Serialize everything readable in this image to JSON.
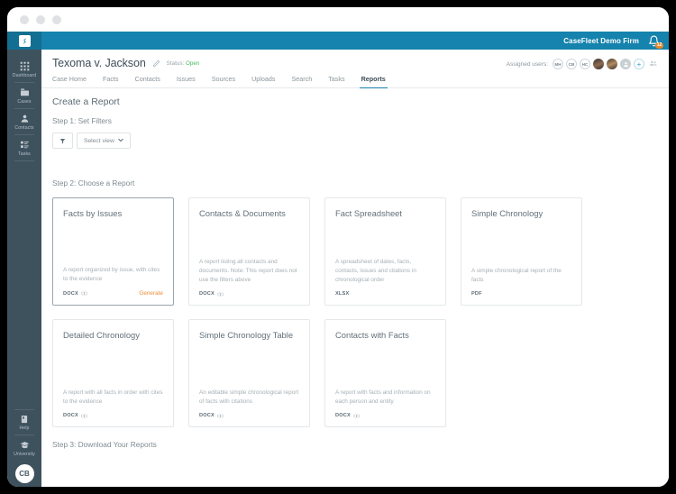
{
  "window": {
    "traffic_lights": [
      "close",
      "minimize",
      "maximize"
    ]
  },
  "brandbar": {
    "logo_glyph": "∈",
    "firm_name": "CaseFleet Demo Firm",
    "bell_icon": "bell-icon",
    "notification_count": "12"
  },
  "rail": {
    "items": [
      {
        "label": "Dashboard",
        "icon": "grid-icon"
      },
      {
        "label": "Cases",
        "icon": "folder-icon"
      },
      {
        "label": "Contacts",
        "icon": "person-icon"
      },
      {
        "label": "Tasks",
        "icon": "task-list-icon"
      }
    ],
    "bottom": [
      {
        "label": "Help",
        "icon": "book-icon"
      },
      {
        "label": "University",
        "icon": "graduation-cap-icon"
      }
    ],
    "avatar_initials": "CB"
  },
  "case_header": {
    "title": "Texoma v. Jackson",
    "edit_icon": "pencil-icon",
    "status_label": "Status:",
    "status_value": "Open",
    "status_color": "#4cb963",
    "assigned_label": "Assigned users:",
    "avatars": [
      {
        "type": "initials",
        "label": "MH"
      },
      {
        "type": "initials",
        "label": "CB"
      },
      {
        "type": "initials",
        "label": "HC"
      },
      {
        "type": "photo-a",
        "label": ""
      },
      {
        "type": "photo-b",
        "label": ""
      },
      {
        "type": "ghost",
        "label": ""
      }
    ],
    "add_user_label": "+",
    "manage_users_icon": "people-group-icon"
  },
  "tabs": [
    {
      "label": "Case Home",
      "active": false
    },
    {
      "label": "Facts",
      "active": false
    },
    {
      "label": "Contacts",
      "active": false
    },
    {
      "label": "Issues",
      "active": false
    },
    {
      "label": "Sources",
      "active": false
    },
    {
      "label": "Uploads",
      "active": false
    },
    {
      "label": "Search",
      "active": false
    },
    {
      "label": "Tasks",
      "active": false
    },
    {
      "label": "Reports",
      "active": true
    }
  ],
  "main": {
    "page_title": "Create a Report",
    "step1_label": "Step 1: Set Filters",
    "filter_icon": "funnel-icon",
    "select_view_label": "Select view",
    "select_view_caret": "⌄",
    "step2_label": "Step 2: Choose a Report",
    "step3_label": "Step 3: Download Your Reports",
    "generate_label": "Generate",
    "cards": [
      {
        "title": "Facts by Issues",
        "description": "A report organized by issue, with cites to the evidence",
        "format": "DOCX",
        "preview_icon": "preview-icon",
        "highlighted": true,
        "show_generate": true
      },
      {
        "title": "Contacts & Documents",
        "description": "A report listing all contacts and documents. Note: This report does not use the filters above",
        "format": "DOCX",
        "preview_icon": "preview-icon",
        "highlighted": false,
        "show_generate": false
      },
      {
        "title": "Fact Spreadsheet",
        "description": "A spreadsheet of dates, facts, contacts, issues and citations in chronological order",
        "format": "XLSX",
        "preview_icon": "",
        "highlighted": false,
        "show_generate": false
      },
      {
        "title": "Simple Chronology",
        "description": "A simple chronological report of the facts",
        "format": "PDF",
        "preview_icon": "",
        "highlighted": false,
        "show_generate": false
      },
      {
        "title": "Detailed Chronology",
        "description": "A report with all facts in order with cites to the evidence",
        "format": "DOCX",
        "preview_icon": "preview-icon",
        "highlighted": false,
        "show_generate": false
      },
      {
        "title": "Simple Chronology Table",
        "description": "An editable simple chronological report of facts with citations",
        "format": "DOCX",
        "preview_icon": "preview-icon",
        "highlighted": false,
        "show_generate": false
      },
      {
        "title": "Contacts with Facts",
        "description": "A report with facts and information on each person and entity",
        "format": "DOCX",
        "preview_icon": "preview-icon",
        "highlighted": false,
        "show_generate": false
      }
    ]
  },
  "colors": {
    "brand_blue": "#1583ad",
    "rail_dark": "#3e525e",
    "accent_orange": "#ec8f3e",
    "status_green": "#4cb963"
  }
}
